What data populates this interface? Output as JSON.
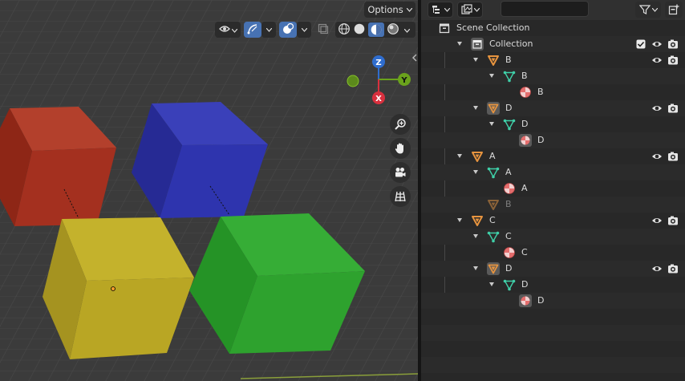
{
  "viewport": {
    "options_label": "Options",
    "icons": [
      "view-icon",
      "gizmo-icon",
      "overlay-icon",
      "xray-icon",
      "wireframe-shading-icon",
      "solid-shading-icon",
      "material-shading-icon",
      "rendered-shading-icon"
    ],
    "nav_gizmo": {
      "x_label": "X",
      "y_label": "Y",
      "z_label": "Z"
    },
    "nav_buttons": [
      "zoom-icon",
      "hand-icon",
      "camera-icon",
      "grid-icon"
    ],
    "cube_colors": {
      "red": "#a1301f",
      "blue": "#3036b0",
      "yellow": "#b9a624",
      "green": "#2ea22e"
    }
  },
  "outliner": {
    "search": {
      "value": "",
      "placeholder": ""
    },
    "rows": [
      {
        "label": "Scene Collection",
        "type": "scene",
        "depth": 0,
        "expander": false,
        "visibility": false
      },
      {
        "label": "Collection",
        "type": "collection",
        "depth": 1,
        "expander": true,
        "visibility": true,
        "checkbox": true
      },
      {
        "label": "B",
        "type": "object",
        "depth": 2,
        "expander": true,
        "visibility": true
      },
      {
        "label": "B",
        "type": "mesh",
        "depth": 3,
        "expander": true,
        "visibility": false
      },
      {
        "label": "B",
        "type": "material",
        "depth": 4,
        "expander": false,
        "visibility": false
      },
      {
        "label": "D",
        "type": "object",
        "depth": 2,
        "expander": true,
        "visibility": true,
        "boxed": true
      },
      {
        "label": "D",
        "type": "mesh",
        "depth": 3,
        "expander": true,
        "visibility": false
      },
      {
        "label": "D",
        "type": "material",
        "depth": 4,
        "expander": false,
        "visibility": false,
        "boxed": true
      },
      {
        "label": "A",
        "type": "object",
        "depth": 1,
        "expander": true,
        "visibility": true
      },
      {
        "label": "A",
        "type": "mesh",
        "depth": 2,
        "expander": true,
        "visibility": false
      },
      {
        "label": "A",
        "type": "material",
        "depth": 3,
        "expander": false,
        "visibility": false
      },
      {
        "label": "B",
        "type": "object",
        "depth": 2,
        "expander": false,
        "visibility": false,
        "dim": true
      },
      {
        "label": "C",
        "type": "object",
        "depth": 1,
        "expander": true,
        "visibility": true
      },
      {
        "label": "C",
        "type": "mesh",
        "depth": 2,
        "expander": true,
        "visibility": false
      },
      {
        "label": "C",
        "type": "material",
        "depth": 3,
        "expander": false,
        "visibility": false
      },
      {
        "label": "D",
        "type": "object",
        "depth": 2,
        "expander": true,
        "visibility": true,
        "boxed": true
      },
      {
        "label": "D",
        "type": "mesh",
        "depth": 3,
        "expander": true,
        "visibility": false
      },
      {
        "label": "D",
        "type": "material",
        "depth": 4,
        "expander": false,
        "visibility": false,
        "boxed": true
      }
    ]
  }
}
